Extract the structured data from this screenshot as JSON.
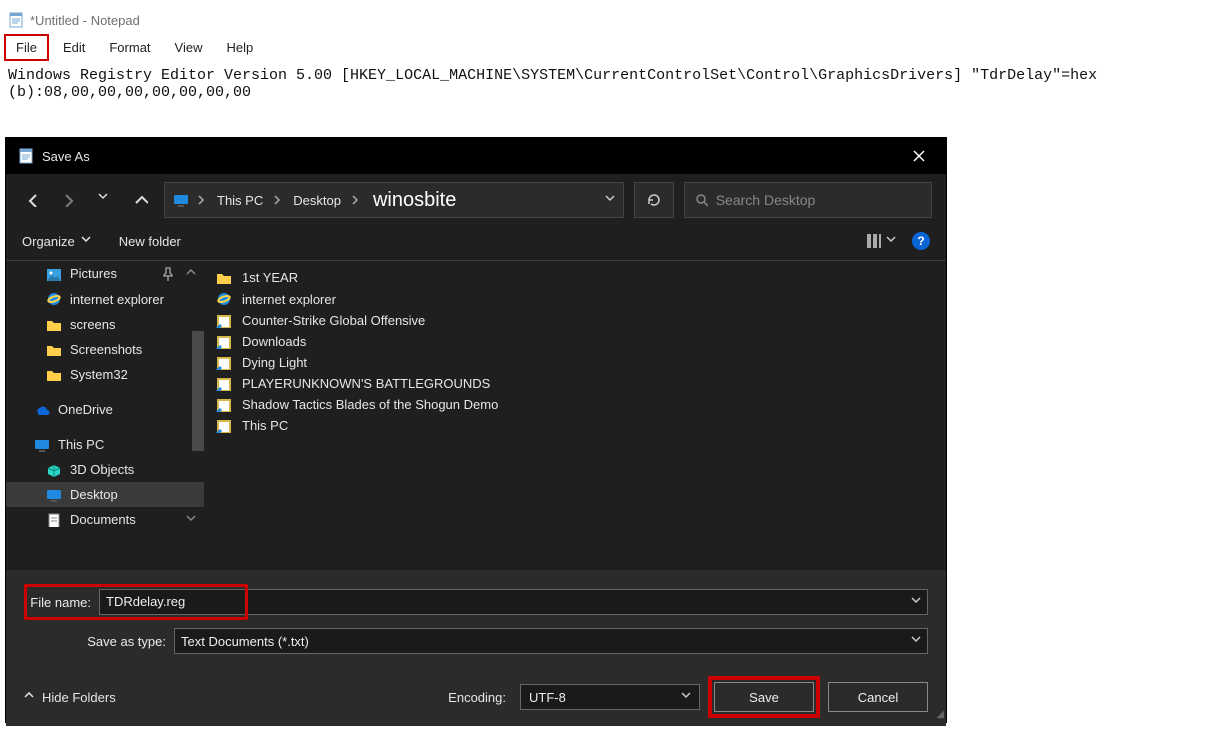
{
  "notepad": {
    "title": "*Untitled - Notepad",
    "menu": {
      "file": "File",
      "edit": "Edit",
      "format": "Format",
      "view": "View",
      "help": "Help"
    },
    "content": "Windows Registry Editor Version 5.00 [HKEY_LOCAL_MACHINE\\SYSTEM\\CurrentControlSet\\Control\\GraphicsDrivers] \"TdrDelay\"=hex\n(b):08,00,00,00,00,00,00,00"
  },
  "saveas": {
    "title": "Save As",
    "breadcrumb": {
      "root": "This PC",
      "mid": "Desktop",
      "leaf": "winosbite"
    },
    "search_placeholder": "Search Desktop",
    "toolbar": {
      "organize": "Organize",
      "newfolder": "New folder"
    },
    "tree": {
      "pictures": "Pictures",
      "ie": "internet explorer",
      "screens": "screens",
      "screenshots": "Screenshots",
      "system32": "System32",
      "onedrive": "OneDrive",
      "thispc": "This PC",
      "objects3d": "3D Objects",
      "desktop": "Desktop",
      "documents": "Documents"
    },
    "files": {
      "f0": "1st YEAR",
      "f1": "internet explorer",
      "f2": "Counter-Strike Global Offensive",
      "f3": "Downloads",
      "f4": "Dying Light",
      "f5": "PLAYERUNKNOWN'S BATTLEGROUNDS",
      "f6": "Shadow Tactics Blades of the Shogun Demo",
      "f7": "This PC"
    },
    "form": {
      "filename_label": "File name:",
      "filename_value": "TDRdelay.reg",
      "type_label": "Save as type:",
      "type_value": "Text Documents (*.txt)"
    },
    "footer": {
      "hide_folders": "Hide Folders",
      "encoding_label": "Encoding:",
      "encoding_value": "UTF-8",
      "save": "Save",
      "cancel": "Cancel"
    }
  }
}
